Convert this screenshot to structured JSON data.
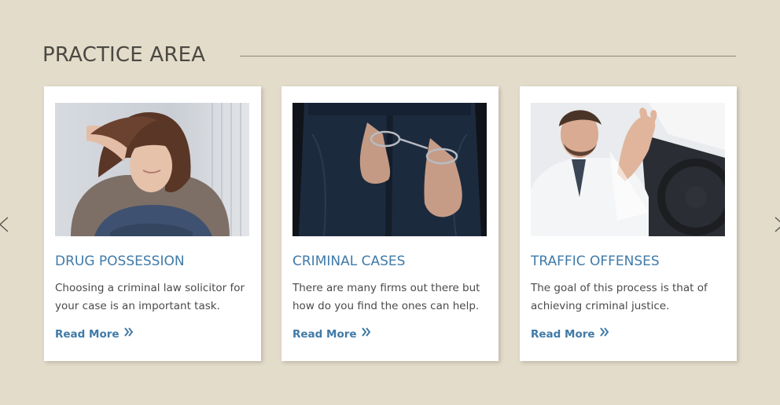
{
  "section": {
    "title": "PRACTICE AREA"
  },
  "carousel": {
    "prev_icon": "chevron-left-icon",
    "next_icon": "chevron-right-icon"
  },
  "cards": [
    {
      "image": "woman-distressed-photo",
      "title": "DRUG POSSESSION",
      "description": "Choosing a criminal law solicitor for your case is an important task.",
      "link_label": "Read More",
      "link_icon": "double-chevron-right-icon"
    },
    {
      "image": "handcuffed-hands-photo",
      "title": "CRIMINAL CASES",
      "description": "There are many firms out there but how do you find the ones can help.",
      "link_label": "Read More",
      "link_icon": "double-chevron-right-icon"
    },
    {
      "image": "angry-driver-photo",
      "title": "TRAFFIC OFFENSES",
      "description": "The goal of this process is that of achieving criminal justice.",
      "link_label": "Read More",
      "link_icon": "double-chevron-right-icon"
    }
  ],
  "colors": {
    "background": "#e4dcca",
    "heading": "#4b4843",
    "accent": "#3f7aa8",
    "body_text": "#4a4a4a",
    "card": "#ffffff"
  }
}
